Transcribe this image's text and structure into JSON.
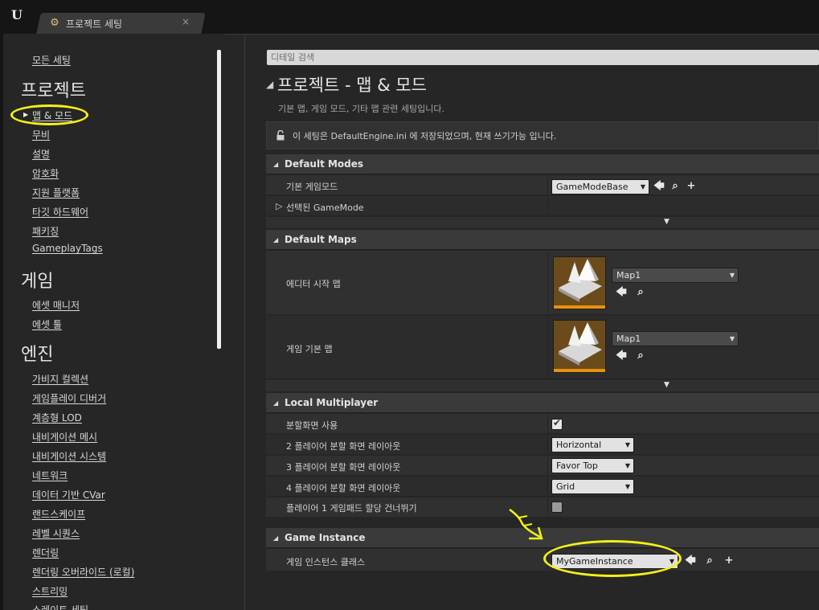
{
  "tab": {
    "title": "프로젝트 세팅",
    "icon": "settings-gear-icon",
    "close": "×"
  },
  "nav": {
    "all_settings": "모든 세팅",
    "categories": [
      {
        "title": "프로젝트",
        "items": [
          "맵 & 모드",
          "무비",
          "설명",
          "암호화",
          "지원 플랫폼",
          "타깃 하드웨어",
          "패키징",
          "GameplayTags"
        ]
      },
      {
        "title": "게임",
        "items": [
          "에셋 매니저",
          "에셋 툴"
        ]
      },
      {
        "title": "엔진",
        "items": [
          "가비지 컬렉션",
          "게임플레이 디버거",
          "계층형 LOD",
          "내비게이션 메시",
          "내비게이션 시스템",
          "네트워크",
          "데이터 기반 CVar",
          "랜드스케이프",
          "레벨 시퀀스",
          "렌더링",
          "렌더링 오버라이드 (로컬)",
          "스트리밍",
          "스레이트 세팅"
        ]
      }
    ],
    "selected": "맵 & 모드"
  },
  "search": {
    "placeholder": "디테일 검색"
  },
  "page": {
    "title": "프로젝트 - 맵 & 모드",
    "description": "기본 맵, 게임 모드, 기타 맵 관련 세팅입니다.",
    "notice": "이 세팅은 DefaultEngine.ini 에 저장되었으며, 현재 쓰기가능 입니다."
  },
  "sections": {
    "default_modes": {
      "title": "Default Modes",
      "default_gamemode_label": "기본 게임모드",
      "default_gamemode_value": "GameModeBase",
      "selected_gamemode_label": "선택된 GameMode"
    },
    "default_maps": {
      "title": "Default Maps",
      "editor_startup_label": "에디터 시작 맵",
      "editor_startup_value": "Map1",
      "game_default_label": "게임 기본 맵",
      "game_default_value": "Map1"
    },
    "local_multiplayer": {
      "title": "Local Multiplayer",
      "split_screen_label": "분할화면 사용",
      "split_screen_checked": true,
      "two_player_label": "2 플레이어 분할 화면 레이아웃",
      "two_player_value": "Horizontal",
      "three_player_label": "3 플레이어 분할 화면 레이아웃",
      "three_player_value": "Favor Top",
      "four_player_label": "4 플레이어 분할 화면 레이아웃",
      "four_player_value": "Grid",
      "skip_gamepad_label": "플레이어 1 게임패드 할당 건너뛰기",
      "skip_gamepad_checked": false
    },
    "game_instance": {
      "title": "Game Instance",
      "class_label": "게임 인스턴스 클래스",
      "class_value": "MyGameInstance"
    }
  },
  "colors": {
    "highlight": "#f4f018",
    "thumb_accent": "#e8920a"
  }
}
